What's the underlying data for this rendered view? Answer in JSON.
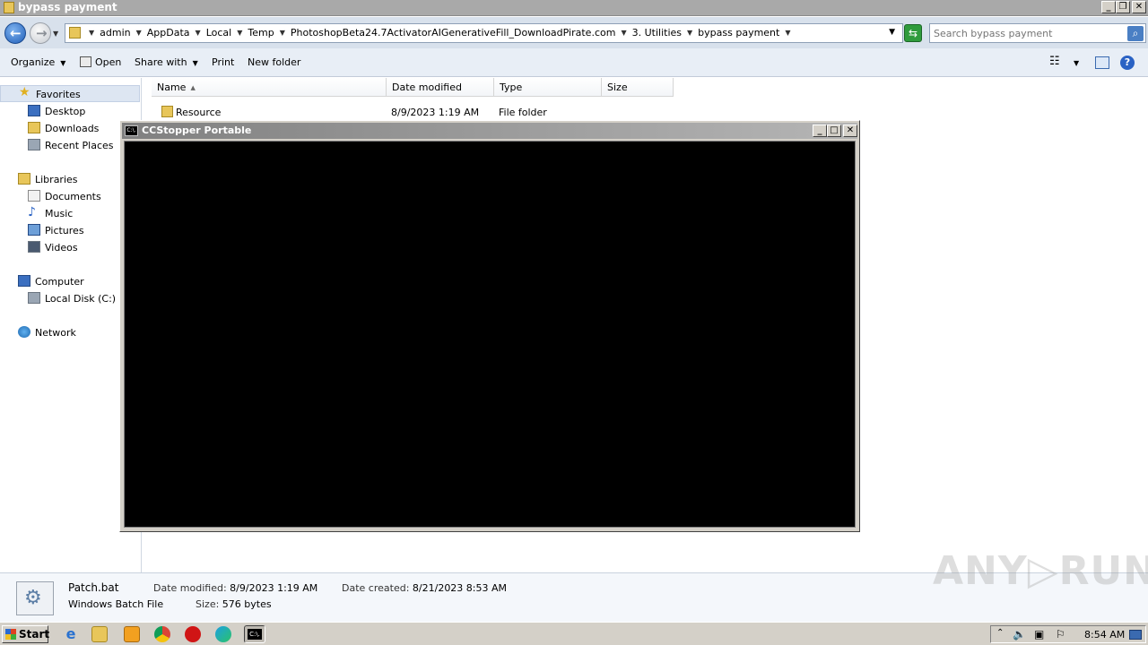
{
  "window": {
    "title": "bypass payment",
    "controls": {
      "minimize": "_",
      "maximize": "❐",
      "close": "✕"
    }
  },
  "address": {
    "crumbs": [
      "admin",
      "AppData",
      "Local",
      "Temp",
      "PhotoshopBeta24.7ActivatorAIGenerativeFill_DownloadPirate.com",
      "3. Utilities",
      "bypass payment"
    ],
    "search_placeholder": "Search bypass payment"
  },
  "toolbar": {
    "organize": "Organize",
    "open": "Open",
    "share_with": "Share with",
    "print": "Print",
    "new_folder": "New folder"
  },
  "navigation": {
    "favorites": "Favorites",
    "desktop": "Desktop",
    "downloads": "Downloads",
    "recent_places": "Recent Places",
    "libraries": "Libraries",
    "documents": "Documents",
    "music": "Music",
    "pictures": "Pictures",
    "videos": "Videos",
    "computer": "Computer",
    "local_disk": "Local Disk (C:)",
    "network": "Network"
  },
  "columns": {
    "name": "Name",
    "date_modified": "Date modified",
    "type": "Type",
    "size": "Size"
  },
  "files": [
    {
      "name": "Resource",
      "date_modified": "8/9/2023 1:19 AM",
      "type": "File folder",
      "size": ""
    }
  ],
  "details": {
    "file_name": "Patch.bat",
    "file_type": "Windows Batch File",
    "date_modified_label": "Date modified:",
    "date_modified": "8/9/2023 1:19 AM",
    "size_label": "Size:",
    "size": "576 bytes",
    "date_created_label": "Date created:",
    "date_created": "8/21/2023 8:53 AM"
  },
  "console": {
    "title": "CCStopper Portable",
    "icon_text": "C:\\."
  },
  "taskbar": {
    "start": "Start",
    "clock": "8:54 AM"
  },
  "watermark": "ANY▷RUN",
  "icons": {
    "favorites": "star-icon",
    "desktop": "desktop-icon",
    "downloads": "downloads-folder-icon",
    "computer": "computer-icon",
    "network": "network-icon"
  }
}
